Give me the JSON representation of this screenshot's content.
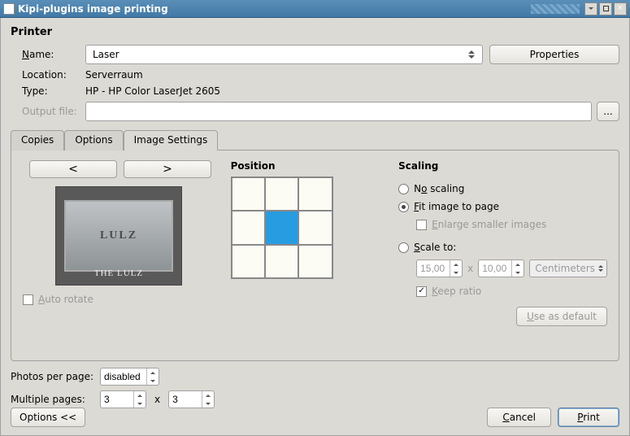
{
  "window": {
    "title": "Kipi-plugins image printing"
  },
  "printer": {
    "group_title": "Printer",
    "name_label": "Name:",
    "name_value": "Laser",
    "properties_label": "Properties",
    "location_label": "Location:",
    "location_value": "Serverraum",
    "type_label": "Type:",
    "type_value": "HP - HP Color LaserJet 2605",
    "outputfile_label": "Output file:",
    "browse_label": "..."
  },
  "tabs": {
    "copies": "Copies",
    "options": "Options",
    "image_settings": "Image Settings"
  },
  "image_settings": {
    "prev_label": "<",
    "next_label": ">",
    "thumb_top": "LULZ",
    "thumb_caption": "THE LULZ",
    "auto_rotate_label": "Auto rotate",
    "position_header": "Position",
    "scaling_header": "Scaling",
    "no_scaling": "No scaling",
    "fit_to_page": "Fit image to page",
    "enlarge_smaller": "Enlarge smaller images",
    "scale_to": "Scale to:",
    "width_value": "15,00",
    "height_value": "10,00",
    "x_sep": "x",
    "units": "Centimeters",
    "keep_ratio": "Keep ratio",
    "use_as_default": "Use as default"
  },
  "bottom": {
    "photos_per_page_label": "Photos per page:",
    "photos_per_page_value": "disabled",
    "multiple_pages_label": "Multiple pages:",
    "cols_value": "3",
    "rows_value": "3",
    "x_sep": "x"
  },
  "buttons": {
    "options_toggle": "Options <<",
    "cancel": "Cancel",
    "print": "Print"
  }
}
